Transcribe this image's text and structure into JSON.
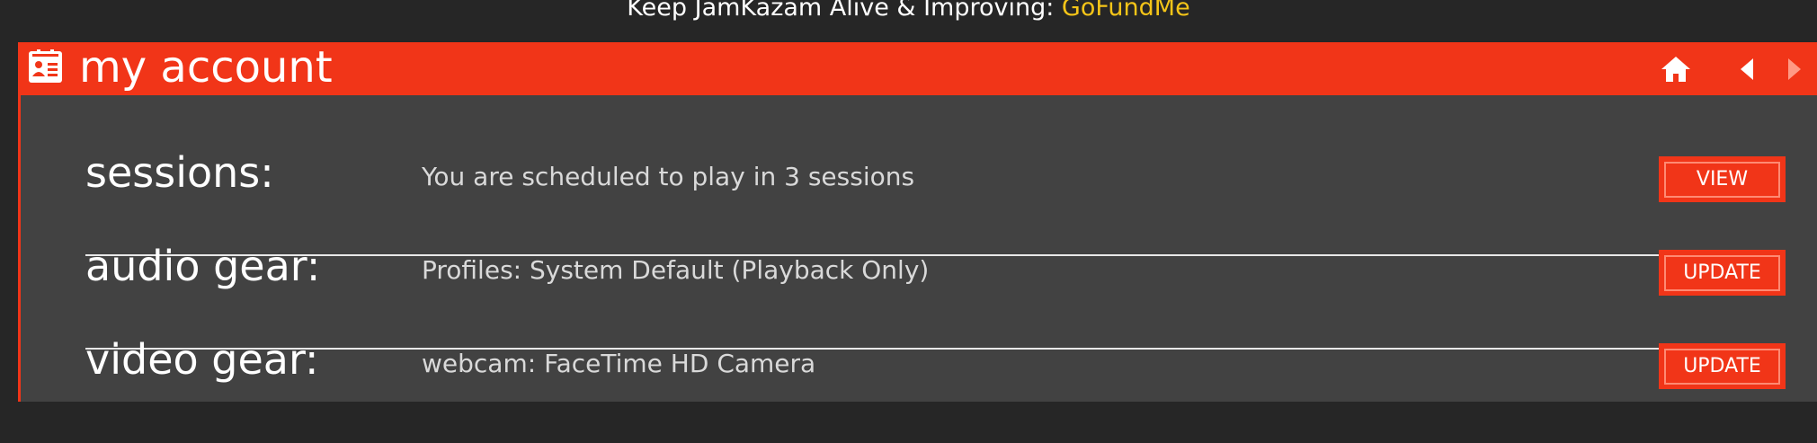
{
  "banner": {
    "text": "Keep JamKazam Alive & Improving: ",
    "link": "GoFundMe"
  },
  "header": {
    "icon": "account-card-icon",
    "title": "my account",
    "nav": {
      "home_icon": "home-icon",
      "back_icon": "back-arrow-icon",
      "forward_icon": "forward-arrow-icon"
    }
  },
  "rows": [
    {
      "label": "sessions:",
      "description": "You are scheduled to play in 3 sessions",
      "button": "VIEW"
    },
    {
      "label": "audio gear:",
      "description": "Profiles: System Default (Playback Only)",
      "button": "UPDATE"
    },
    {
      "label": "video gear:",
      "description": "webcam: FaceTime HD Camera",
      "button": "UPDATE"
    }
  ],
  "colors": {
    "accent": "#f13518",
    "panel": "#424242",
    "background": "#262626",
    "link": "#f5c518"
  }
}
